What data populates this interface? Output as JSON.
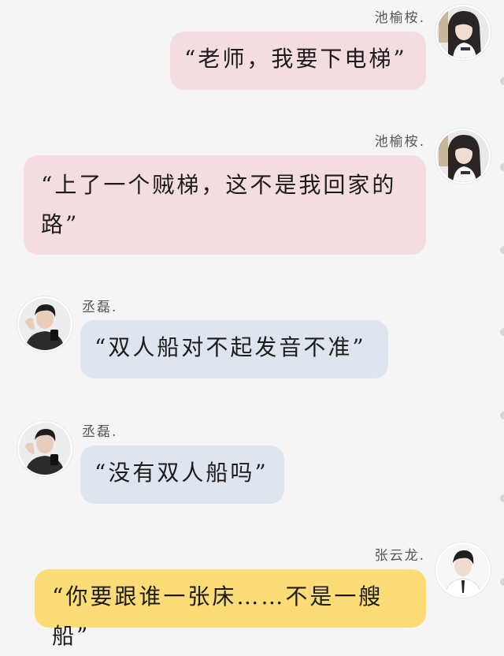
{
  "messages": [
    {
      "sender": "池榆桉.",
      "side": "right",
      "bubble_color": "#f3dde0",
      "text": "“老师，我要下电梯”",
      "avatar": "female-avatar"
    },
    {
      "sender": "池榆桉.",
      "side": "right",
      "bubble_color": "#f3dde0",
      "text": "“上了一个贼梯，这不是我回家的路”",
      "avatar": "female-avatar"
    },
    {
      "sender": "丞磊.",
      "side": "left",
      "bubble_color": "#dfe5ee",
      "text": "“双人船对不起发音不准”",
      "avatar": "male-avatar-dark"
    },
    {
      "sender": "丞磊.",
      "side": "left",
      "bubble_color": "#dfe5ee",
      "text": "“没有双人船吗”",
      "avatar": "male-avatar-dark"
    },
    {
      "sender": "张云龙.",
      "side": "right",
      "bubble_color": "#fbdc76",
      "text": "“你要跟谁一张床……不是一艘船”",
      "avatar": "male-avatar-white"
    }
  ],
  "colors": {
    "background": "#f5f5f5",
    "pink_bubble": "#f3dde0",
    "blue_bubble": "#dfe5ee",
    "yellow_bubble": "#fbdc76"
  }
}
